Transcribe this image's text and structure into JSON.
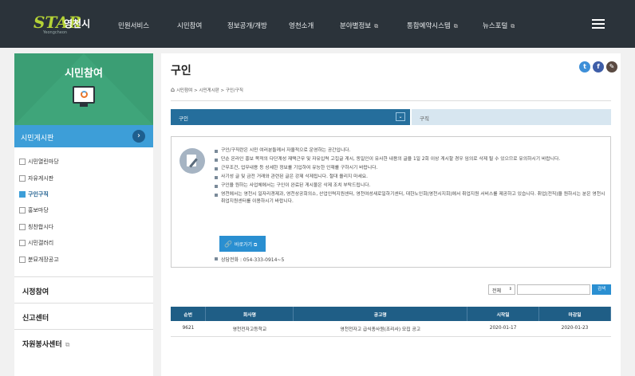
{
  "header": {
    "logo_star": "STAR",
    "logo_city": "영천시",
    "logo_sub": "Yeongcheon",
    "nav": [
      {
        "label": "민원서비스",
        "ext": ""
      },
      {
        "label": "시민참여",
        "ext": ""
      },
      {
        "label": "정보공개/개방",
        "ext": ""
      },
      {
        "label": "영천소개",
        "ext": ""
      },
      {
        "label": "분야별정보",
        "ext": "⧉"
      },
      {
        "label": "통합예약시스템",
        "ext": "⧉"
      },
      {
        "label": "뉴스포털",
        "ext": "⧉"
      }
    ]
  },
  "sidebar": {
    "title": "시민참여",
    "section_active": "시민게시판",
    "section_btn": "›",
    "items": [
      {
        "label": "시민열린마당",
        "active": false
      },
      {
        "label": "자유게시판",
        "active": false
      },
      {
        "label": "구인구직",
        "active": true
      },
      {
        "label": "홍보마당",
        "active": false
      },
      {
        "label": "칭찬합시다",
        "active": false
      },
      {
        "label": "시민갤러리",
        "active": false
      },
      {
        "label": "분묘개장공고",
        "active": false
      }
    ],
    "sections": [
      {
        "label": "시정참여",
        "icon": ""
      },
      {
        "label": "신고센터",
        "icon": ""
      },
      {
        "label": "자원봉사센터",
        "icon": "⧉"
      }
    ]
  },
  "main": {
    "title": "구인",
    "breadcrumb": "시민참여 > 시민게시판 > 구인/구직",
    "sns": [
      {
        "name": "twitter",
        "glyph": "t",
        "color": "#3d8fd8"
      },
      {
        "name": "facebook",
        "glyph": "f",
        "color": "#3e5ea8"
      },
      {
        "name": "kakaostory",
        "glyph": "✎",
        "color": "#5a4a42"
      }
    ],
    "tab_active": "구인",
    "tab_other": "구직",
    "tab_dropdown": "⌄",
    "notices": [
      "구인/구직란은 시민 여러분들께서 자율적으로 운영하는 공간입니다.",
      "단순 온라인 홍보 목적의 다단계성 재택근무 및 자유입력 고집글 게시, 동일인이 유사한 내용의 글을 1일 2회 이상 게시할 경우 임의로 삭제 될 수 있으므로 유의하시기 바랍니다.",
      "근무조건, 업무내용 등 상세한 정보를 기입하여 유능한 인재를 구하시기 바랍니다.",
      "사기성 글 및 금전 거래와 관련된 글은 강제 삭제됩니다. 절대 올리지 마세요.",
      "구인을 원하는 사업체에서는 구인이 완료된 게시물은 삭제 조치 부탁드립니다.",
      "영천에서는 영천시 일자리경제과, 영천상공회의소, 산업인력지원센터, 영천여성새로일하기센터, 대한노인회(영천시지회)에서 취업지원 서비스를 제공하고 있습니다. 취업(전직)을 원하시는 분은 영천시취업지원센터를 이용하시기 바랍니다."
    ],
    "go_button": "바로가기",
    "go_ext": "⧉",
    "phone": "상담전화 : 054-333-0914~5",
    "search": {
      "select_value": "전체",
      "input_value": "",
      "button": "검색"
    },
    "table": {
      "headers": [
        "순번",
        "회사명",
        "공고명",
        "시작일",
        "마감일"
      ],
      "rows": [
        [
          "9621",
          "영천전자고등학교",
          "영천전자고 급식종사원(조리사) 모집 공고",
          "2020-01-17",
          "2020-01-23"
        ]
      ]
    }
  }
}
